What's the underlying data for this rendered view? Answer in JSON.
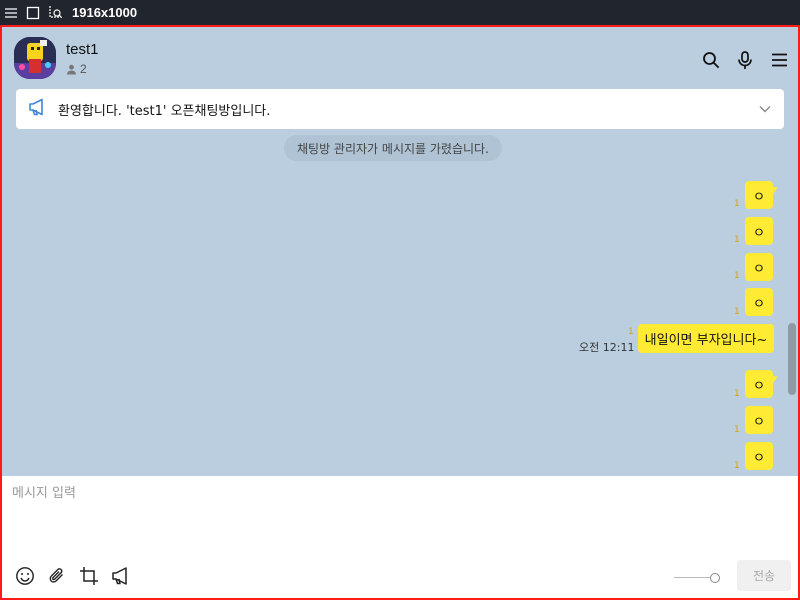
{
  "toolbar": {
    "resolution": "1916x1000",
    "icons": [
      "menu-icon",
      "square-icon",
      "crop-search-icon"
    ]
  },
  "chat_room": {
    "title": "test1",
    "member_count": "2",
    "header_icons": [
      "search-icon",
      "microphone-icon",
      "menu-icon"
    ]
  },
  "notice": {
    "text": "환영합니다. 'test1' 오픈채팅방입니다."
  },
  "system_message": "채팅방 관리자가 메시지를 가렸습니다.",
  "messages": [
    {
      "text": "ㅇ",
      "read": "1"
    },
    {
      "text": "ㅇ",
      "read": "1"
    },
    {
      "text": "ㅇ",
      "read": "1"
    },
    {
      "text": "ㅇ",
      "read": "1"
    },
    {
      "text": "내일이면 부자입니다~",
      "read": "1",
      "time": "오전 12:11"
    },
    {
      "text": "ㅇ",
      "read": "1"
    },
    {
      "text": "ㅇ",
      "read": "1"
    },
    {
      "text": "ㅇ",
      "read": "1"
    }
  ],
  "composer": {
    "placeholder": "메시지 입력",
    "send_label": "전송",
    "tools": [
      "emoji-icon",
      "paperclip-icon",
      "crop-icon",
      "megaphone-icon"
    ]
  },
  "colors": {
    "chat_bg": "#bacee0",
    "bubble": "#ffeb33",
    "frame_border": "#ff1a1a"
  }
}
